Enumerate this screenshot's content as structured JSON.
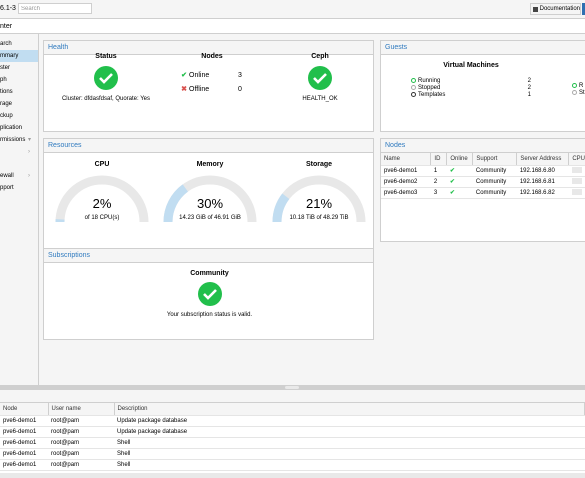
{
  "topbar": {
    "version": "6.1-3",
    "search_placeholder": "Search",
    "doc_label": "Documentation"
  },
  "header": {
    "title": "nter"
  },
  "sidebar": {
    "items": [
      {
        "label": "arch"
      },
      {
        "label": "mmary"
      },
      {
        "label": "ster"
      },
      {
        "label": "ph"
      },
      {
        "label": "tions"
      },
      {
        "label": "rage"
      },
      {
        "label": "ckup"
      },
      {
        "label": "plication"
      },
      {
        "label": "rmissions"
      },
      {
        "label": ""
      },
      {
        "label": ""
      },
      {
        "label": "ewall"
      },
      {
        "label": "pport"
      }
    ]
  },
  "health": {
    "title": "Health",
    "status_label": "Status",
    "cluster_text": "Cluster: dfdasfdsaf, Quorate: Yes",
    "nodes_label": "Nodes",
    "online_label": "Online",
    "online_count": "3",
    "offline_label": "Offline",
    "offline_count": "0",
    "ceph_label": "Ceph",
    "ceph_status": "HEALTH_OK"
  },
  "guests": {
    "title": "Guests",
    "vm_label": "Virtual Machines",
    "rows": [
      {
        "label": "Running",
        "count": "2"
      },
      {
        "label": "Stopped",
        "count": "2"
      },
      {
        "label": "Templates",
        "count": "1"
      }
    ],
    "right_rows": [
      {
        "label": "R"
      },
      {
        "label": "St"
      }
    ]
  },
  "resources": {
    "title": "Resources",
    "cpu": {
      "label": "CPU",
      "value": "2%",
      "fraction": 0.02,
      "sub": "of 18 CPU(s)"
    },
    "memory": {
      "label": "Memory",
      "value": "30%",
      "fraction": 0.3,
      "sub": "14.23 GiB of 46.91 GiB"
    },
    "storage": {
      "label": "Storage",
      "value": "21%",
      "fraction": 0.21,
      "sub": "10.18 TiB of 48.29 TiB"
    }
  },
  "nodes": {
    "title": "Nodes",
    "headers": [
      "Name",
      "ID",
      "Online",
      "Support",
      "Server Address",
      "CPU"
    ],
    "rows": [
      {
        "name": "pve6-demo1",
        "id": "1",
        "support": "Community",
        "address": "192.168.6.80"
      },
      {
        "name": "pve6-demo2",
        "id": "2",
        "support": "Community",
        "address": "192.168.6.81"
      },
      {
        "name": "pve6-demo3",
        "id": "3",
        "support": "Community",
        "address": "192.168.6.82"
      }
    ]
  },
  "subscriptions": {
    "title": "Subscriptions",
    "level": "Community",
    "message": "Your subscription status is valid."
  },
  "tasks": {
    "headers": [
      "Node",
      "User name",
      "Description"
    ],
    "rows": [
      {
        "node": "pve6-demo1",
        "user": "root@pam",
        "desc": "Update package database"
      },
      {
        "node": "pve6-demo1",
        "user": "root@pam",
        "desc": "Update package database"
      },
      {
        "node": "pve6-demo1",
        "user": "root@pam",
        "desc": "Shell"
      },
      {
        "node": "pve6-demo1",
        "user": "root@pam",
        "desc": "Shell"
      },
      {
        "node": "pve6-demo1",
        "user": "root@pam",
        "desc": "Shell"
      }
    ]
  },
  "colors": {
    "accent": "#2f7abf",
    "ok": "#21bf4b",
    "gauge_bg": "#e8e8e8",
    "gauge_fill": "#c1ddf1"
  }
}
